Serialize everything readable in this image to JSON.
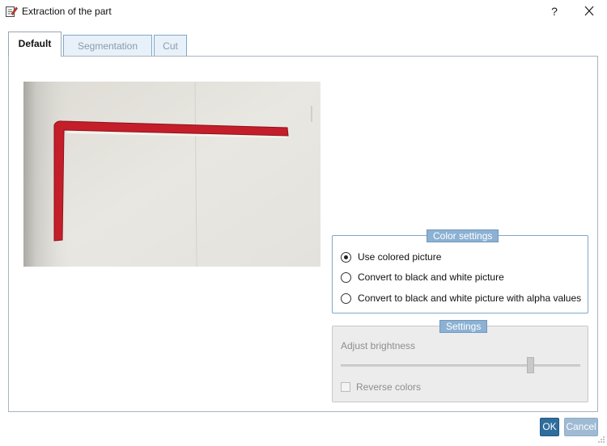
{
  "window": {
    "title": "Extraction of the part",
    "help_label": "?",
    "icon": "edit-document-icon",
    "close_icon": "close-icon"
  },
  "tabs": [
    {
      "label": "Default",
      "active": true
    },
    {
      "label": "Segmentation",
      "active": false
    },
    {
      "label": "Cut",
      "active": false
    }
  ],
  "picture": {
    "description_icon": "part-photo"
  },
  "color_settings": {
    "legend": "Color settings",
    "options": [
      {
        "label": "Use colored picture",
        "checked": true
      },
      {
        "label": "Convert to black and white picture",
        "checked": false
      },
      {
        "label": "Convert to black and white picture with alpha values",
        "checked": false
      }
    ]
  },
  "settings": {
    "legend": "Settings",
    "brightness_label": "Adjust brightness",
    "brightness_level": 0.8,
    "enabled": false,
    "reverse_colors_label": "Reverse colors",
    "reverse_colors_checked": false
  },
  "buttons": {
    "ok_label": "OK",
    "cancel_label": "Cancel"
  },
  "colors": {
    "accent": "#2f6e9c",
    "tab_border": "#7fa7c9",
    "legend_bg": "#8cb1d3",
    "part_red": "#c41e2a"
  }
}
